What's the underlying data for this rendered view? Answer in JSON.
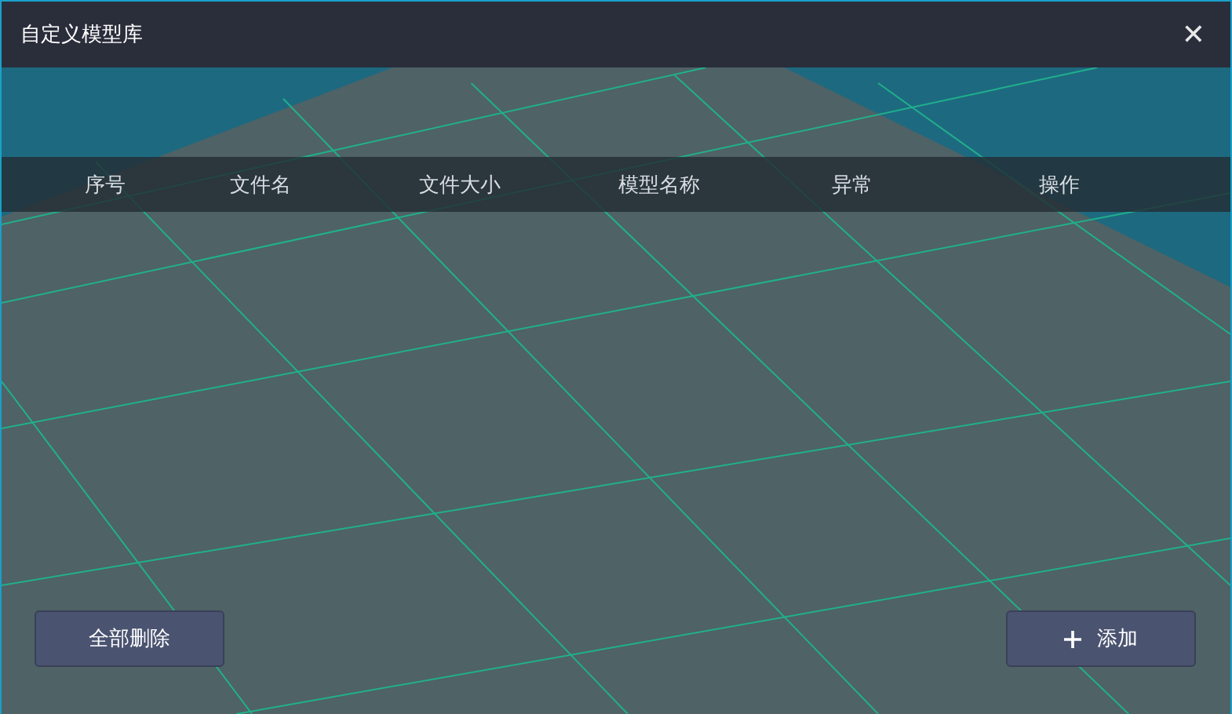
{
  "window": {
    "title": "自定义模型库",
    "close": "✕"
  },
  "table": {
    "columns": [
      "序号",
      "文件名",
      "文件大小",
      "模型名称",
      "异常",
      "操作"
    ]
  },
  "buttons": [
    {
      "kind": "delete-all",
      "label": "全部删除"
    },
    {
      "kind": "add",
      "label": "添加"
    }
  ]
}
